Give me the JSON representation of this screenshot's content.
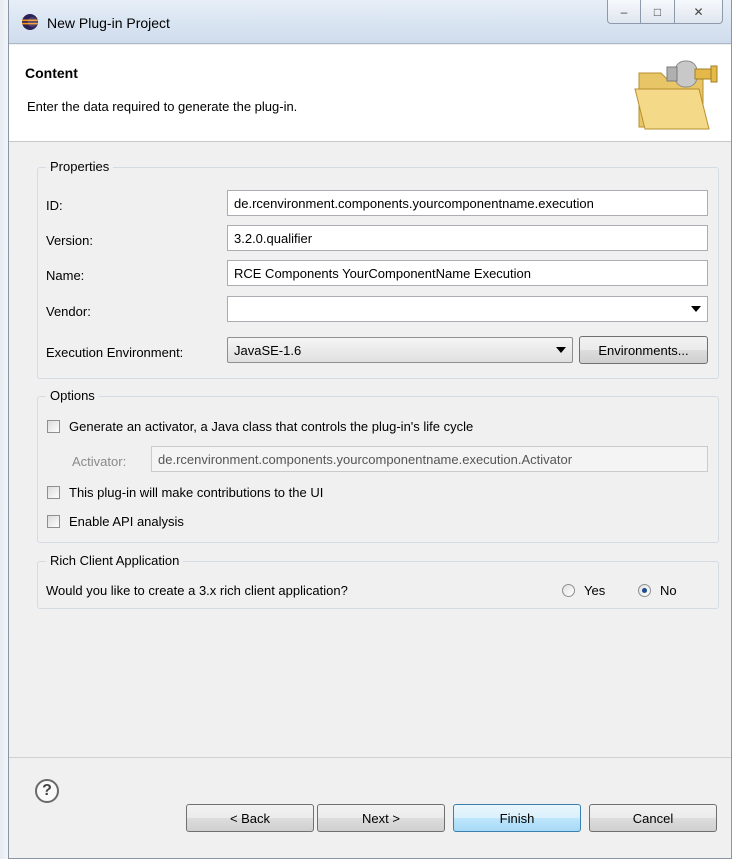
{
  "window": {
    "title": "New Plug-in Project",
    "icon": "eclipse-icon",
    "minimize_glyph": "‒",
    "maximize_glyph": "□",
    "close_glyph": "✕"
  },
  "header": {
    "title": "Content",
    "description": "Enter the data required to generate the plug-in.",
    "icon": "folder-plugin-icon"
  },
  "properties": {
    "group_label": "Properties",
    "id_label": "ID:",
    "id_value": "de.rcenvironment.components.yourcomponentname.execution",
    "version_label": "Version:",
    "version_value": "3.2.0.qualifier",
    "name_label": "Name:",
    "name_value": "RCE Components YourComponentName Execution",
    "vendor_label": "Vendor:",
    "vendor_value": "",
    "exec_env_label": "Execution Environment:",
    "exec_env_value": "JavaSE-1.6",
    "environments_button": "Environments..."
  },
  "options": {
    "group_label": "Options",
    "activator_checkbox": "Generate an activator, a Java class that controls the plug-in's life cycle",
    "activator_checked": false,
    "activator_label": "Activator:",
    "activator_value": "de.rcenvironment.components.yourcomponentname.execution.Activator",
    "ui_checkbox": "This plug-in will make contributions to the UI",
    "ui_checked": false,
    "api_checkbox": "Enable API analysis",
    "api_checked": false
  },
  "rcp": {
    "group_label": "Rich Client Application",
    "question": "Would you like to create a 3.x rich client application?",
    "yes_label": "Yes",
    "no_label": "No",
    "selected": "No"
  },
  "footer": {
    "help_glyph": "?",
    "back_button": "< Back",
    "next_button": "Next >",
    "finish_button": "Finish",
    "cancel_button": "Cancel"
  }
}
